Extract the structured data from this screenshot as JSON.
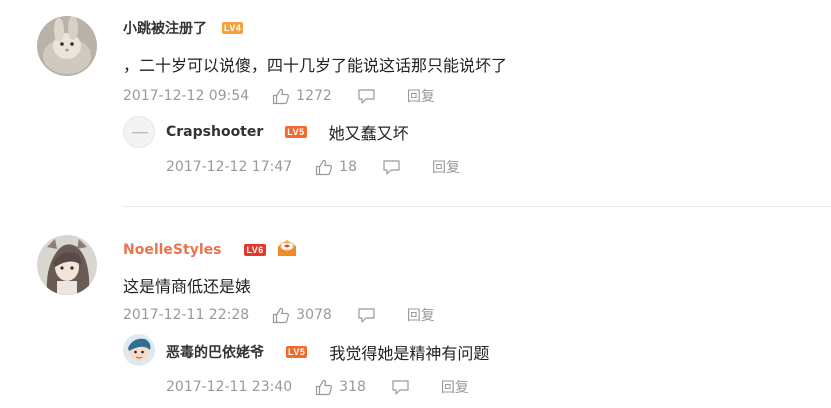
{
  "comments": [
    {
      "username": "小跳被注册了",
      "level": "LV4",
      "text": "，二十岁可以说傻，四十几岁了能说这话那只能说坏了",
      "time": "2017-12-12 09:54",
      "likes": "1272",
      "reply_label": "回复",
      "reply": {
        "username": "Crapshooter",
        "level": "LV5",
        "text": "她又蠢又坏",
        "time": "2017-12-12 17:47",
        "likes": "18",
        "reply_label": "回复"
      }
    },
    {
      "username": "NoelleStyles",
      "level": "LV6",
      "text": "这是情商低还是婊",
      "time": "2017-12-11 22:28",
      "likes": "3078",
      "reply_label": "回复",
      "reply": {
        "username": "恶毒的巴依姥爷",
        "level": "LV5",
        "text": "我觉得她是精神有问题",
        "time": "2017-12-11 23:40",
        "likes": "318",
        "reply_label": "回复"
      }
    }
  ],
  "colors": {
    "name_default": "#333333",
    "name_highlight": "#eb7350",
    "meta": "#999999",
    "divider": "#e8e8e8"
  }
}
